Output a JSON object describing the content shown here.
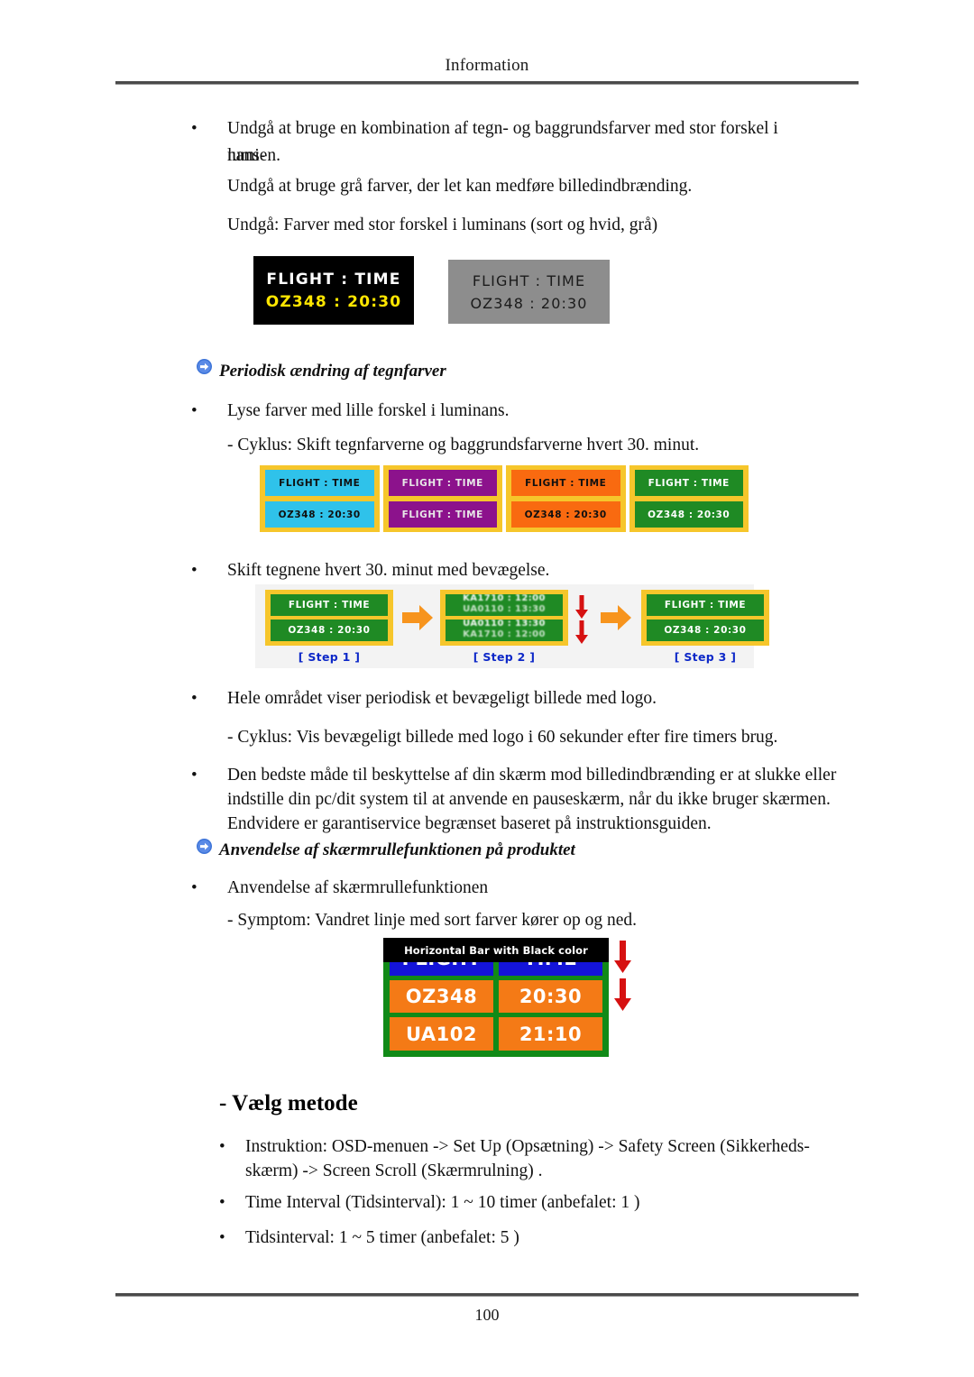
{
  "header": {
    "title": "Information"
  },
  "footer": {
    "page_number": "100"
  },
  "body": {
    "b1_line1": "Undgå at bruge en kombination af tegn- og baggrundsfarver med stor forskel i lumi-",
    "b1_line2": "nansen.",
    "p2": "Undgå at bruge grå farver, der let kan medføre billedindbrænding.",
    "p3": "Undgå: Farver med stor forskel i luminans (sort og hvid, grå)",
    "section1_heading": "Periodisk ændring af tegnfarver",
    "b2": "Lyse farver med lille forskel i luminans.",
    "p4": "- Cyklus: Skift tegnfarverne og baggrundsfarverne hvert 30. minut.",
    "b3": "Skift tegnene hvert 30. minut med bevægelse.",
    "b4": "Hele området viser periodisk et bevægeligt billede med logo.",
    "p5": "- Cyklus: Vis bevægeligt billede med logo i 60 sekunder efter fire timers brug.",
    "b5_line1": "Den bedste måde til beskyttelse af din skærm mod billedindbrænding er at slukke eller",
    "b5_line2": "indstille din pc/dit system til at anvende en pauseskærm, når du ikke bruger skærmen.",
    "b5_line3": "Endvidere er garantiservice begrænset baseret på instruktionsguiden.",
    "section2_heading": "Anvendelse af skærmrullefunktionen på produktet",
    "b6": "Anvendelse af skærmrullefunktionen",
    "p6": "- Symptom: Vandret linje med sort farver kører op og ned.",
    "subtitle": "- Vælg metode",
    "b7_line1": "Instruktion: OSD-menuen -> Set Up (Opsætning) -> Safety Screen (Sikkerheds-",
    "b7_line2": "skærm) -> Screen Scroll (Skærmrulning) .",
    "b8": "Time Interval (Tidsinterval): 1 ~ 10 timer (anbefalet: 1 )",
    "b9": "Tidsinterval: 1 ~ 5 timer (anbefalet: 5 )",
    "bullet_glyph": "•"
  },
  "figures": {
    "contrast_pair": {
      "black_board": {
        "row1": "FLIGHT : TIME",
        "row2": "OZ348  :  20:30",
        "bg": "#000000",
        "row1_color": "#ffffff",
        "row2_color": "#ffe600"
      },
      "gray_board": {
        "row1": "FLIGHT : TIME",
        "row2": "OZ348  :  20:30",
        "bg": "#8d8d8d",
        "text_color": "#1b1b1b"
      }
    },
    "color_cycle": {
      "border_color": "#f6c62b",
      "panels": [
        {
          "name": "cyan-panel",
          "bg": "#2fc2ea",
          "text_color": "#101010",
          "row1": "FLIGHT : TIME",
          "row2": "OZ348  :  20:30"
        },
        {
          "name": "purple-panel",
          "bg": "#8c128c",
          "text_color": "#e8e8e8",
          "row1": "FLIGHT : TIME",
          "row2": "FLIGHT : TIME"
        },
        {
          "name": "orange-panel",
          "bg": "#f96a10",
          "text_color": "#101010",
          "row1": "FLIGHT : TIME",
          "row2": "OZ348  :  20:30"
        },
        {
          "name": "green-panel",
          "bg": "#1f8a24",
          "text_color": "#ffffff",
          "row1": "FLIGHT : TIME",
          "row2": "OZ348  :  20:30"
        }
      ]
    },
    "scroll_steps": {
      "background": "#f3f3f3",
      "border_color": "#f6c62b",
      "cell_bg": "#1f8a24",
      "arrow_color": "#f7941d",
      "down_arrow_color": "#d61111",
      "label_color": "#0d28c8",
      "steps": [
        {
          "label": "[ Step 1 ]",
          "row1": "FLIGHT : TIME",
          "row2": "OZ348  :  20:30"
        },
        {
          "label": "[ Step 2 ]",
          "row1": "KA1710 : 12:00",
          "row2": "UA0110 : 13:30"
        },
        {
          "label": "[ Step 3 ]",
          "row1": "FLIGHT : TIME",
          "row2": "OZ348  :  20:30"
        }
      ]
    },
    "horizontal_bar_board": {
      "overlay_label": "Horizontal Bar with Black color",
      "overlay_bg": "#000000",
      "panel_bg": "#118a17",
      "header_bg": "#1414d8",
      "cell_bg": "#f47a16",
      "arrow_color": "#d61111",
      "header": [
        "FLIGHT",
        "TIME"
      ],
      "rows": [
        [
          "OZ348",
          "20:30"
        ],
        [
          "UA102",
          "21:10"
        ]
      ]
    }
  },
  "icons": {
    "arrow_bullet_color": "#3d74d8"
  }
}
